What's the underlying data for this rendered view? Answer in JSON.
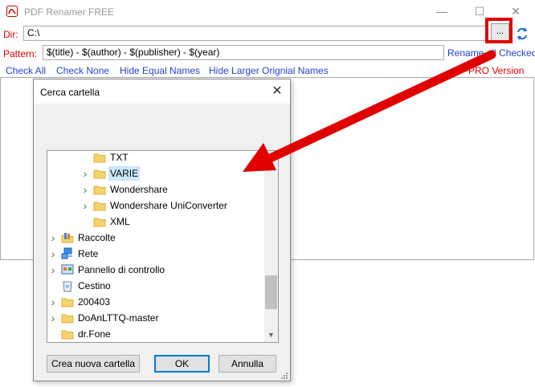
{
  "window": {
    "title": "PDF Renamer FREE",
    "controls": {
      "minimize": "—",
      "maximize": "☐",
      "close": "✕"
    }
  },
  "dir": {
    "label": "Dir:",
    "value": "C:\\",
    "browse_label": "..."
  },
  "pattern": {
    "label": "Pattern:",
    "value": "$(title) - $(author) - $(publisher) - $(year)"
  },
  "rename_all": "Rename all Checked",
  "links": {
    "check_all": "Check All",
    "check_none": "Check None",
    "hide_equal": "Hide Equal Names",
    "hide_larger": "Hide Larger Orignial Names",
    "pro": "PRO Version"
  },
  "dialog": {
    "title": "Cerca cartella",
    "close": "✕",
    "tree": [
      {
        "label": "TXT",
        "icon": "folder-icon",
        "expandable": false,
        "selected": false
      },
      {
        "label": "VARIE",
        "icon": "folder-icon",
        "expandable": true,
        "selected": true
      },
      {
        "label": "Wondershare",
        "icon": "folder-icon",
        "expandable": true,
        "selected": false
      },
      {
        "label": "Wondershare UniConverter",
        "icon": "folder-icon",
        "expandable": true,
        "selected": false
      },
      {
        "label": "XML",
        "icon": "folder-icon",
        "expandable": false,
        "selected": false
      },
      {
        "label": "Raccolte",
        "icon": "libraries-icon",
        "expandable": true,
        "selected": false
      },
      {
        "label": "Rete",
        "icon": "network-icon",
        "expandable": true,
        "selected": false
      },
      {
        "label": "Pannello di controllo",
        "icon": "control-panel-icon",
        "expandable": true,
        "selected": false
      },
      {
        "label": "Cestino",
        "icon": "recycle-bin-icon",
        "expandable": false,
        "selected": false
      },
      {
        "label": "200403",
        "icon": "folder-icon",
        "expandable": true,
        "selected": false
      },
      {
        "label": "DoAnLTTQ-master",
        "icon": "folder-icon",
        "expandable": true,
        "selected": false
      },
      {
        "label": "dr.Fone",
        "icon": "folder-icon",
        "expandable": false,
        "selected": false
      }
    ],
    "buttons": {
      "new_folder": "Crea nuova cartella",
      "ok": "OK",
      "cancel": "Annulla"
    }
  },
  "colors": {
    "label_red": "#dd0000",
    "link_blue": "#2244cc",
    "highlight_red": "#e00000",
    "selection": "#cce8ff",
    "folder": "#f5d36b"
  }
}
